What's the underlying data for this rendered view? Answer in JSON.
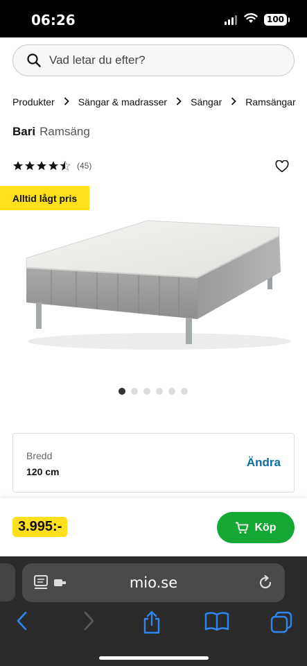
{
  "status": {
    "time": "06:26",
    "battery": "100"
  },
  "search": {
    "placeholder": "Vad letar du efter?"
  },
  "breadcrumb": [
    "Produkter",
    "Sängar & madrasser",
    "Sängar",
    "Ramsängar"
  ],
  "product": {
    "brand": "Bari",
    "type": "Ramsäng",
    "rating": 4.5,
    "review_count": "(45)",
    "badge": "Alltid lågt pris",
    "image_dots": 6,
    "active_dot": 0
  },
  "option": {
    "label": "Bredd",
    "value": "120 cm",
    "change": "Ändra"
  },
  "buy": {
    "price": "3.995:-",
    "button": "Köp"
  },
  "browser": {
    "url": "mio.se"
  },
  "colors": {
    "yellow": "#ffe01b",
    "green": "#15a835",
    "link": "#0c6e9e"
  },
  "icons": [
    "search-icon",
    "chevron-right-icon",
    "star-icon",
    "heart-icon",
    "cart-icon",
    "reader-icon",
    "reload-icon",
    "back-icon",
    "forward-icon",
    "share-icon",
    "bookmarks-icon",
    "tabs-icon"
  ]
}
